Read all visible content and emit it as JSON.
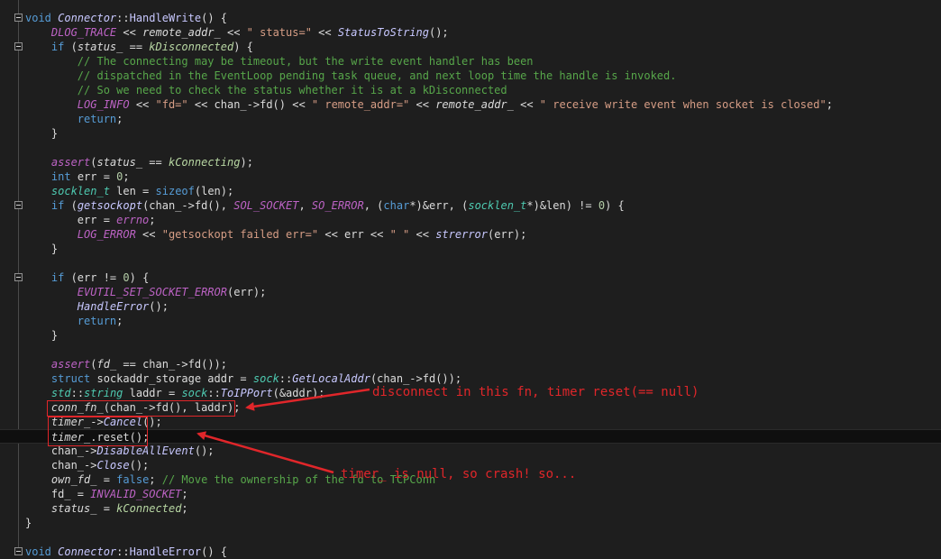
{
  "annotations": {
    "disconnect_note": "disconnect in this fn, timer reset(== null)",
    "crash_note": "timer_ is null, so crash! so...",
    "color": "#e0262a"
  },
  "lines": [
    [
      [
        "void ",
        "kw"
      ],
      [
        "Connector",
        "fn it"
      ],
      [
        "::",
        ""
      ],
      [
        "HandleWrite",
        "fn"
      ],
      [
        "() {",
        ""
      ]
    ],
    [
      [
        "    ",
        ""
      ],
      [
        "DLOG_TRACE",
        "mac"
      ],
      [
        " << ",
        ""
      ],
      [
        "remote_addr_",
        "mem"
      ],
      [
        " << ",
        ""
      ],
      [
        "\" status=\"",
        "st"
      ],
      [
        " << ",
        ""
      ],
      [
        "StatusToString",
        "fn it"
      ],
      [
        "();",
        ""
      ]
    ],
    [
      [
        "    ",
        ""
      ],
      [
        "if",
        "kw"
      ],
      [
        " (",
        ""
      ],
      [
        "status_",
        "mem"
      ],
      [
        " == ",
        ""
      ],
      [
        "kDisconnected",
        "en"
      ],
      [
        ") {",
        ""
      ]
    ],
    [
      [
        "        // The connecting may be timeout, but the write event handler has been",
        "cm"
      ]
    ],
    [
      [
        "        // dispatched in the EventLoop pending task queue, and next loop time the handle is invoked.",
        "cm"
      ]
    ],
    [
      [
        "        // So we need to check the status whether it is at a kDisconnected",
        "cm"
      ]
    ],
    [
      [
        "        ",
        ""
      ],
      [
        "LOG_INFO",
        "mac"
      ],
      [
        " << ",
        ""
      ],
      [
        "\"fd=\"",
        "st"
      ],
      [
        " << chan_->fd() << ",
        ""
      ],
      [
        "\" remote_addr=\"",
        "st"
      ],
      [
        " << ",
        ""
      ],
      [
        "remote_addr_",
        "mem"
      ],
      [
        " << ",
        ""
      ],
      [
        "\" receive write event when socket is closed\"",
        "st"
      ],
      [
        ";",
        ""
      ]
    ],
    [
      [
        "        ",
        ""
      ],
      [
        "return",
        "kw"
      ],
      [
        ";",
        ""
      ]
    ],
    [
      [
        "    }",
        ""
      ]
    ],
    [
      [
        "",
        ""
      ]
    ],
    [
      [
        "    ",
        ""
      ],
      [
        "assert",
        "mac"
      ],
      [
        "(",
        ""
      ],
      [
        "status_",
        "mem"
      ],
      [
        " == ",
        ""
      ],
      [
        "kConnecting",
        "en"
      ],
      [
        ");",
        ""
      ]
    ],
    [
      [
        "    ",
        ""
      ],
      [
        "int",
        "kw"
      ],
      [
        " err = ",
        ""
      ],
      [
        "0",
        "num"
      ],
      [
        ";",
        ""
      ]
    ],
    [
      [
        "    ",
        ""
      ],
      [
        "socklen_t",
        "ty it"
      ],
      [
        " len = ",
        ""
      ],
      [
        "sizeof",
        "kw"
      ],
      [
        "(len);",
        ""
      ]
    ],
    [
      [
        "    ",
        ""
      ],
      [
        "if",
        "kw"
      ],
      [
        " (",
        ""
      ],
      [
        "getsockopt",
        "fn it"
      ],
      [
        "(chan_->fd(), ",
        ""
      ],
      [
        "SOL_SOCKET",
        "mac"
      ],
      [
        ", ",
        ""
      ],
      [
        "SO_ERROR",
        "mac"
      ],
      [
        ", (",
        ""
      ],
      [
        "char",
        "kw"
      ],
      [
        "*)&err, (",
        ""
      ],
      [
        "socklen_t",
        "ty it"
      ],
      [
        "*)&len) != ",
        ""
      ],
      [
        "0",
        "num"
      ],
      [
        ") {",
        ""
      ]
    ],
    [
      [
        "        err = ",
        ""
      ],
      [
        "errno",
        "mac"
      ],
      [
        ";",
        ""
      ]
    ],
    [
      [
        "        ",
        ""
      ],
      [
        "LOG_ERROR",
        "mac"
      ],
      [
        " << ",
        ""
      ],
      [
        "\"getsockopt failed err=\"",
        "st"
      ],
      [
        " << err << ",
        ""
      ],
      [
        "\" \"",
        "st"
      ],
      [
        " << ",
        ""
      ],
      [
        "strerror",
        "fn it"
      ],
      [
        "(err);",
        ""
      ]
    ],
    [
      [
        "    }",
        ""
      ]
    ],
    [
      [
        "",
        ""
      ]
    ],
    [
      [
        "    ",
        ""
      ],
      [
        "if",
        "kw"
      ],
      [
        " (err != ",
        ""
      ],
      [
        "0",
        "num"
      ],
      [
        ") {",
        ""
      ]
    ],
    [
      [
        "        ",
        ""
      ],
      [
        "EVUTIL_SET_SOCKET_ERROR",
        "mac"
      ],
      [
        "(err);",
        ""
      ]
    ],
    [
      [
        "        ",
        ""
      ],
      [
        "HandleError",
        "fn it"
      ],
      [
        "();",
        ""
      ]
    ],
    [
      [
        "        ",
        ""
      ],
      [
        "return",
        "kw"
      ],
      [
        ";",
        ""
      ]
    ],
    [
      [
        "    }",
        ""
      ]
    ],
    [
      [
        "",
        ""
      ]
    ],
    [
      [
        "    ",
        ""
      ],
      [
        "assert",
        "mac"
      ],
      [
        "(",
        ""
      ],
      [
        "fd_",
        "mem"
      ],
      [
        " == chan_->fd());",
        ""
      ]
    ],
    [
      [
        "    ",
        ""
      ],
      [
        "struct",
        "kw"
      ],
      [
        " sockaddr_storage addr = ",
        ""
      ],
      [
        "sock",
        "ty it"
      ],
      [
        "::",
        ""
      ],
      [
        "GetLocalAddr",
        "fn it"
      ],
      [
        "(chan_->fd());",
        ""
      ]
    ],
    [
      [
        "    ",
        ""
      ],
      [
        "std",
        "ty it"
      ],
      [
        "::",
        ""
      ],
      [
        "string",
        "ty it"
      ],
      [
        " laddr = ",
        ""
      ],
      [
        "sock",
        "ty it"
      ],
      [
        "::",
        ""
      ],
      [
        "ToIPPort",
        "fn it"
      ],
      [
        "(&addr);",
        ""
      ]
    ],
    [
      [
        "    ",
        ""
      ],
      [
        "conn_fn_",
        "mem"
      ],
      [
        "(chan_->fd(), laddr);",
        ""
      ]
    ],
    [
      [
        "    ",
        ""
      ],
      [
        "timer_",
        "mem"
      ],
      [
        "->",
        ""
      ],
      [
        "Cancel",
        "fn it"
      ],
      [
        "();",
        ""
      ]
    ],
    [
      [
        "    ",
        ""
      ],
      [
        "timer_",
        "mem"
      ],
      [
        ".reset();",
        ""
      ]
    ],
    [
      [
        "    chan_->",
        ""
      ],
      [
        "DisableAllEvent",
        "fn it"
      ],
      [
        "();",
        ""
      ]
    ],
    [
      [
        "    chan_->",
        ""
      ],
      [
        "Close",
        "fn it"
      ],
      [
        "();",
        ""
      ]
    ],
    [
      [
        "    ",
        ""
      ],
      [
        "own_fd_",
        "mem"
      ],
      [
        " = ",
        ""
      ],
      [
        "false",
        "kw"
      ],
      [
        "; ",
        ""
      ],
      [
        "// Move the ownership of the fd to TCPConn",
        "cm"
      ]
    ],
    [
      [
        "    fd_ = ",
        ""
      ],
      [
        "INVALID_SOCKET",
        "mac"
      ],
      [
        ";",
        ""
      ]
    ],
    [
      [
        "    ",
        ""
      ],
      [
        "status_",
        "mem"
      ],
      [
        " = ",
        ""
      ],
      [
        "kConnected",
        "en"
      ],
      [
        ";",
        ""
      ]
    ],
    [
      [
        "}",
        ""
      ]
    ],
    [
      [
        "",
        ""
      ]
    ],
    [
      [
        "void ",
        "kw"
      ],
      [
        "Connector",
        "fn it"
      ],
      [
        "::",
        ""
      ],
      [
        "HandleError",
        "fn"
      ],
      [
        "() {",
        ""
      ]
    ]
  ]
}
